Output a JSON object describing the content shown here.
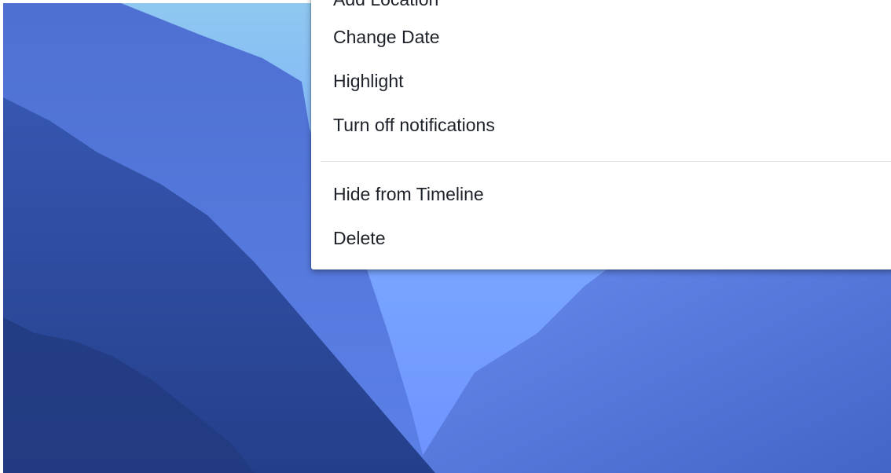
{
  "background": {
    "description_icon": "mountain-valley-cover-photo",
    "colors": {
      "sky_top": "#8ec8f0",
      "sky_bottom": "#6e92ff",
      "ridge_far": "#5a7ee0",
      "ridge_mid": "#3f62c2",
      "ridge_near": "#2c4a9e",
      "right_slope": "#4f72d6"
    }
  },
  "context_menu": {
    "items": [
      {
        "label": "Add Location"
      },
      {
        "label": "Change Date"
      },
      {
        "label": "Highlight"
      },
      {
        "label": "Turn off notifications"
      },
      {
        "label": "Hide from Timeline"
      },
      {
        "label": "Delete"
      }
    ]
  }
}
